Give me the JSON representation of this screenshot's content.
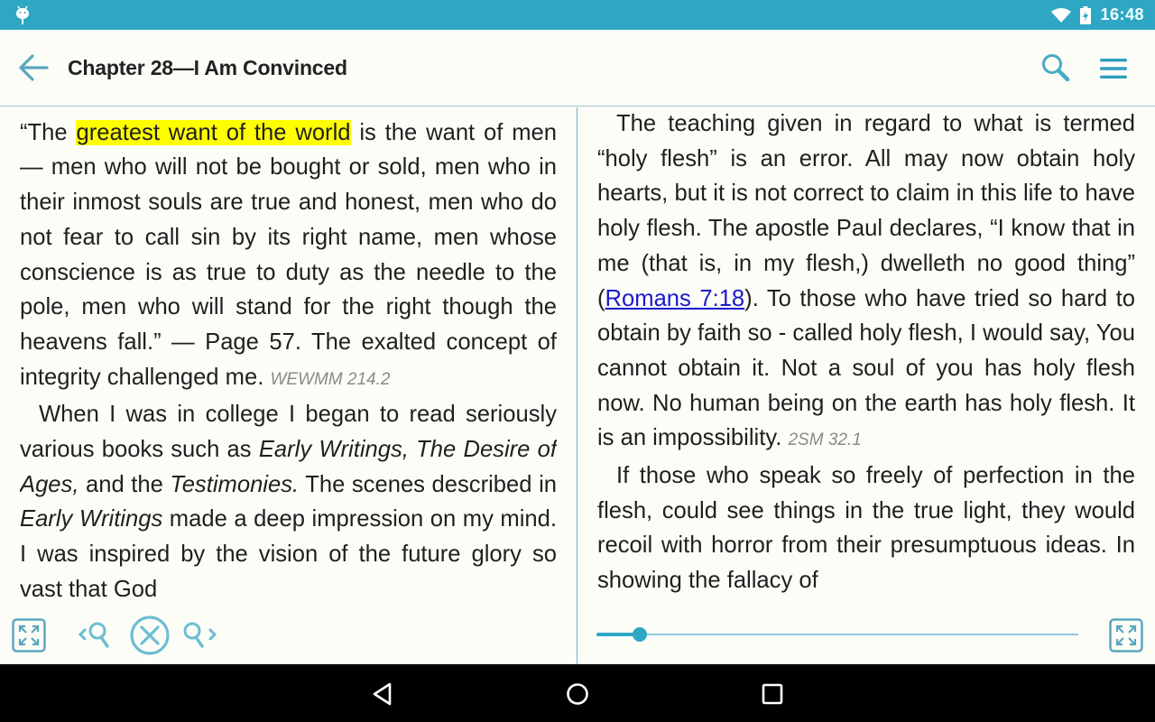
{
  "status_bar": {
    "time": "16:48",
    "icons": [
      "android-debug-icon",
      "wifi-icon",
      "battery-charging-icon"
    ]
  },
  "app_bar": {
    "title": "Chapter 28—I Am Convinced",
    "back_icon": "arrow-left-icon",
    "search_icon": "search-icon",
    "menu_icon": "hamburger-menu-icon"
  },
  "left_pane": {
    "partial_top_line": "",
    "paragraph1": {
      "before": "“The ",
      "highlight": "greatest want of the world",
      "after": " is the want of men — men who will not be bought or sold, men who in their inmost souls are true and honest, men who do not fear to call sin by its right name, men whose conscience is as true to duty as the needle to the pole, men who will stand for the right though the heavens fall.” — Page 57. The exalted concept of integrity challenged me.",
      "ref": "WEWMM 214.2"
    },
    "paragraph2": {
      "t1": "When I was in college I began to read seriously various books such as ",
      "i1": "Early Writings,",
      "t2": " ",
      "i2": "The Desire of Ages,",
      "t3": " and the ",
      "i3": "Testimonies.",
      "t4": " The scenes described in ",
      "i4": "Early Writings",
      "t5": " made a deep impression on my mind. I was inspired by the vision of the future glory so vast that God"
    },
    "toolbar": {
      "fullscreen_icon": "expand-fullscreen-icon",
      "prev_match_icon": "search-previous-icon",
      "close_search_icon": "close-circle-icon",
      "next_match_icon": "search-next-icon"
    }
  },
  "right_pane": {
    "paragraph1": {
      "t1": "The teaching given in regard to what is termed “holy flesh” is an error. All may now obtain holy hearts, but it is not correct to claim in this life to have holy flesh. The apostle Paul declares, “I know that in me (that is, in my flesh,) dwelleth no good thing” (",
      "link": "Romans 7:18",
      "t2": "). To those who have tried so hard to obtain by faith so - called holy flesh, I would say, You cannot obtain it. Not a soul of you has holy flesh now. No human being on the earth has holy flesh. It is an impossibility.",
      "ref": "2SM 32.1"
    },
    "paragraph2": {
      "text": "If those who speak so freely of perfection in the flesh, could see things in the true light, they would recoil with horror from their presumptuous ideas. In showing the fallacy of"
    },
    "progress_slider": {
      "value_percent": 9
    },
    "toolbar": {
      "fullscreen_icon": "expand-fullscreen-icon"
    }
  },
  "nav_bar": {
    "back": "nav-back-icon",
    "home": "nav-home-icon",
    "recents": "nav-recents-icon"
  },
  "colors": {
    "accent": "#2ea7c4",
    "highlight": "#ffff00",
    "link": "#1a1ad0",
    "reference": "#8a8a8a",
    "background": "#fdfdf8"
  }
}
